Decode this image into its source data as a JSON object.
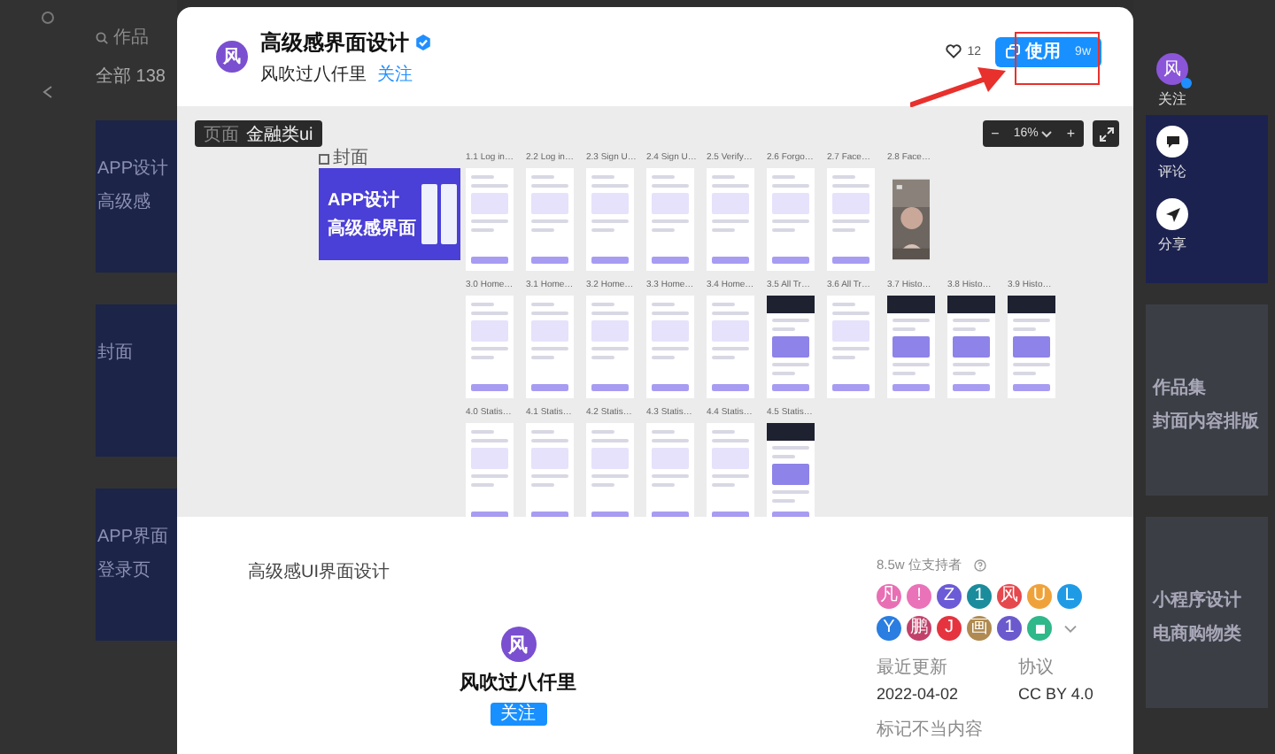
{
  "backdrop_left": {
    "search": "作品",
    "tab": "全部 138",
    "cards": [
      {
        "lines": [
          "APP设计",
          "高级感"
        ]
      },
      {
        "lines": [
          "封面"
        ]
      },
      {
        "lines": [
          "APP界面",
          "登录页"
        ]
      }
    ]
  },
  "backdrop_right": {
    "actions": [
      {
        "kind": "avatar",
        "icon_text": "风",
        "label": "关注"
      },
      {
        "kind": "comment",
        "label": "评论"
      },
      {
        "kind": "share",
        "label": "分享"
      }
    ],
    "cards": [
      {
        "lines": [
          "作品集",
          "封面内容排版"
        ]
      },
      {
        "lines": [
          "小程序设计",
          "电商购物类"
        ]
      }
    ]
  },
  "header": {
    "avatar": "风",
    "title": "高级感界面设计",
    "author": "风吹过八仟里",
    "follow": "关注",
    "likes": "12",
    "use_button": {
      "label": "使用",
      "count": "9w"
    }
  },
  "annotations": {
    "highlight_box": true,
    "arrow": true
  },
  "canvas": {
    "page_chip": {
      "label": "页面",
      "value": "金融类ui"
    },
    "zoom": {
      "minus": "−",
      "value": "16%",
      "plus": "+"
    },
    "cover": {
      "label": "封面",
      "lines": [
        "APP设计",
        "高级感界面"
      ]
    },
    "rows": [
      [
        {
          "label": "1.1 Log in…",
          "kind": "light"
        },
        {
          "label": "2.2 Log in…",
          "kind": "light"
        },
        {
          "label": "2.3 Sign U…",
          "kind": "light"
        },
        {
          "label": "2.4 Sign U…",
          "kind": "light"
        },
        {
          "label": "2.5 Verify…",
          "kind": "light"
        },
        {
          "label": "2.6 Forgo…",
          "kind": "light"
        },
        {
          "label": "2.7 Face…",
          "kind": "light"
        },
        {
          "label": "2.8 Face…",
          "kind": "picture"
        }
      ],
      [
        {
          "label": "3.0 Home…",
          "kind": "light"
        },
        {
          "label": "3.1 Home…",
          "kind": "light"
        },
        {
          "label": "3.2 Home…",
          "kind": "light"
        },
        {
          "label": "3.3 Home…",
          "kind": "light"
        },
        {
          "label": "3.4 Home…",
          "kind": "light"
        },
        {
          "label": "3.5 All Tr…",
          "kind": "dark"
        },
        {
          "label": "3.6 All Tr…",
          "kind": "light"
        },
        {
          "label": "3.7 Histo…",
          "kind": "dark"
        },
        {
          "label": "3.8 Histo…",
          "kind": "dark"
        },
        {
          "label": "3.9 Histo…",
          "kind": "dark"
        }
      ],
      [
        {
          "label": "4.0 Statis…",
          "kind": "light"
        },
        {
          "label": "4.1 Statis…",
          "kind": "light"
        },
        {
          "label": "4.2 Statis…",
          "kind": "light"
        },
        {
          "label": "4.3 Statis…",
          "kind": "light"
        },
        {
          "label": "4.4 Statis…",
          "kind": "light"
        },
        {
          "label": "4.5 Statis…",
          "kind": "dark"
        }
      ]
    ]
  },
  "description": "高级感UI界面设计",
  "author_card": {
    "avatar": "风",
    "name": "风吹过八仟里",
    "follow": "关注"
  },
  "supporters": {
    "title": "8.5w 位支持者",
    "avatars": [
      {
        "letter": "凡",
        "color": "#e86fb4"
      },
      {
        "letter": "!",
        "color": "#ea72b8"
      },
      {
        "letter": "Z",
        "color": "#6b5bd6"
      },
      {
        "letter": "1",
        "color": "#1a8c9c"
      },
      {
        "letter": "风",
        "color": "#e5484d"
      },
      {
        "letter": "U",
        "color": "#f0a23a"
      },
      {
        "letter": "L",
        "color": "#1f9be6"
      },
      {
        "letter": "Y",
        "color": "#2a7de1"
      },
      {
        "letter": "鹏",
        "color": "#c2416a"
      },
      {
        "letter": "J",
        "color": "#e5343f"
      },
      {
        "letter": "画",
        "color": "#b08a50"
      },
      {
        "letter": "1",
        "color": "#6a5acd"
      },
      {
        "color": "#2fb88a"
      }
    ]
  },
  "meta": [
    {
      "label": "最近更新",
      "value": "2022-04-02"
    },
    {
      "label": "协议",
      "value": "CC BY 4.0"
    }
  ],
  "report": "标记不当内容"
}
